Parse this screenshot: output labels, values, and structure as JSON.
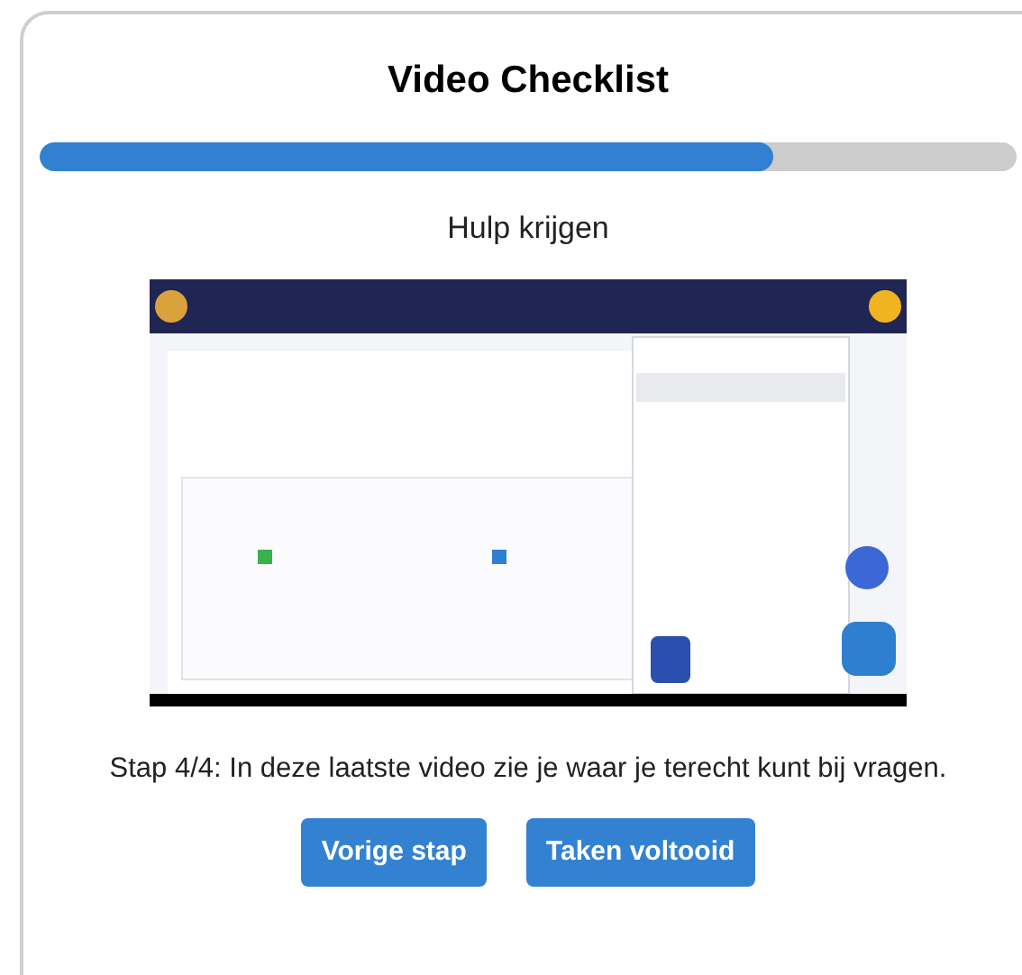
{
  "title": "Video Checklist",
  "progress": {
    "level": 0.75
  },
  "step_title": "Hulp krijgen",
  "description": "Stap 4/4: In deze laatste video zie je waar je terecht kunt bij vragen.",
  "buttons": [
    "Vorige stap",
    "Taken voltooid"
  ]
}
